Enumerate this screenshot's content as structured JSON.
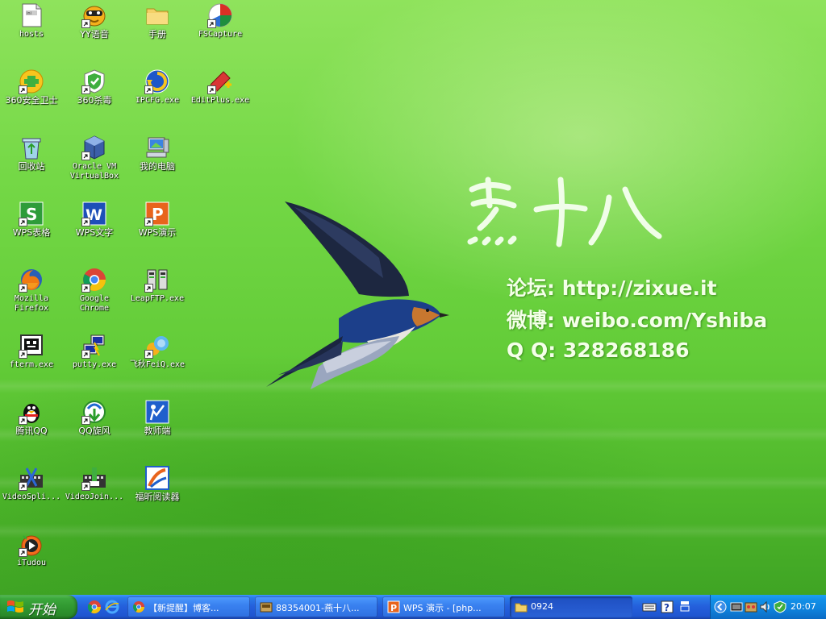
{
  "wallpaper": {
    "brand_text": "燕十八",
    "forum_line": "论坛: http://zixue.it",
    "weibo_line": "微博: weibo.com/Yshiba",
    "qq_line": "Q Q: 328268186"
  },
  "desktop_icons": [
    {
      "label": "hosts",
      "icon": "document-icon"
    },
    {
      "label": "YY语音",
      "icon": "yy-voice-icon"
    },
    {
      "label": "手册",
      "icon": "folder-icon"
    },
    {
      "label": "FSCapture",
      "icon": "fscapture-icon"
    },
    {
      "label": "360安全卫士",
      "icon": "security-360-icon"
    },
    {
      "label": "360杀毒",
      "icon": "antivirus-360-icon"
    },
    {
      "label": "IPCFG.exe",
      "icon": "ipcfg-icon"
    },
    {
      "label": "EditPlus.exe",
      "icon": "editplus-icon"
    },
    {
      "label": "回收站",
      "icon": "recycle-bin-icon"
    },
    {
      "label": "Oracle VM VirtualBox",
      "icon": "virtualbox-icon"
    },
    {
      "label": "我的电脑",
      "icon": "my-computer-icon"
    },
    {
      "label": "WPS表格",
      "icon": "wps-spreadsheet-icon"
    },
    {
      "label": "WPS文字",
      "icon": "wps-writer-icon"
    },
    {
      "label": "WPS演示",
      "icon": "wps-presentation-icon"
    },
    {
      "label": "Mozilla Firefox",
      "icon": "firefox-icon"
    },
    {
      "label": "Google Chrome",
      "icon": "chrome-icon"
    },
    {
      "label": "LeapFTP.exe",
      "icon": "leapftp-icon"
    },
    {
      "label": "fterm.exe",
      "icon": "fterm-icon"
    },
    {
      "label": "putty.exe",
      "icon": "putty-icon"
    },
    {
      "label": "飞秋FeiQ.exe",
      "icon": "feiq-icon"
    },
    {
      "label": "腾讯QQ",
      "icon": "qq-penguin-icon"
    },
    {
      "label": "QQ旋风",
      "icon": "qq-whirlwind-icon"
    },
    {
      "label": "教师端",
      "icon": "teacher-client-icon"
    },
    {
      "label": "VideoSpli...",
      "icon": "video-splitter-icon"
    },
    {
      "label": "VideoJoin...",
      "icon": "video-joiner-icon"
    },
    {
      "label": "福昕阅读器",
      "icon": "foxit-reader-icon"
    },
    {
      "label": "iTudou",
      "icon": "itudou-icon"
    }
  ],
  "taskbar": {
    "start_label": "开始",
    "tasks": [
      {
        "label": "【新提醒】博客...",
        "icon": "chrome-icon"
      },
      {
        "label": "88354001-燕十八...",
        "icon": "app-window-icon"
      },
      {
        "label": "WPS 演示 - [php...",
        "icon": "wps-presentation-icon"
      },
      {
        "label": "0924",
        "icon": "folder-icon"
      }
    ],
    "clock": "20:07"
  }
}
